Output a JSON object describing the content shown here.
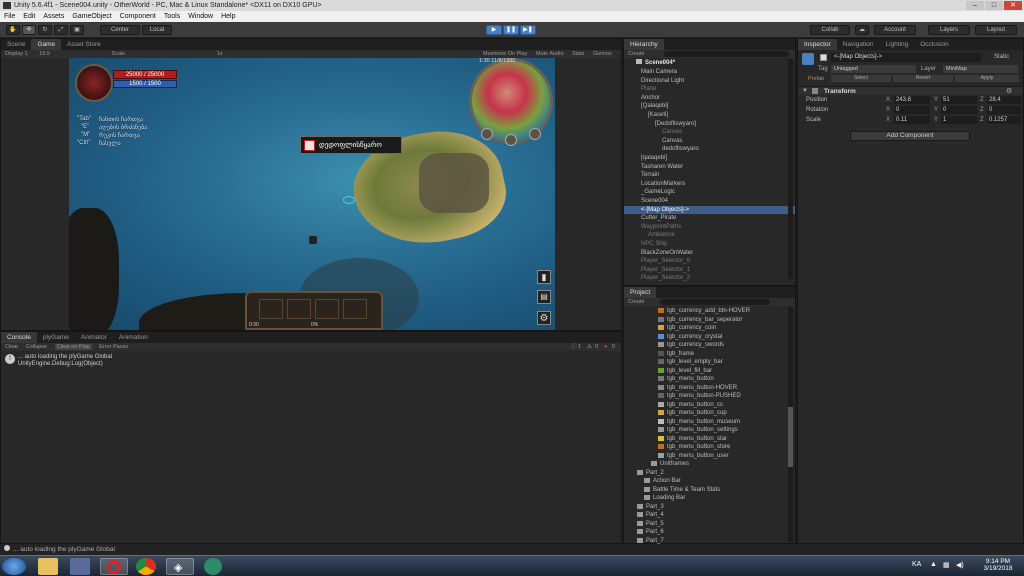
{
  "window": {
    "title": "Unity 5.6.4f1 - Scene004.unity - OtherWorld - PC, Mac & Linux Standalone* <DX11 on DX10 GPU>"
  },
  "menu": [
    "File",
    "Edit",
    "Assets",
    "GameObject",
    "Component",
    "Tools",
    "Window",
    "Help"
  ],
  "toolbar": {
    "pivot": "Center",
    "space": "Local",
    "collab": "Collab",
    "account": "Account",
    "layers": "Layers",
    "layout": "Layout"
  },
  "game_panel": {
    "tabs": [
      "Scene",
      "Game",
      "Asset Store"
    ],
    "display": "Display 1",
    "aspect": "16:9",
    "scale_label": "Scale",
    "scale_value": "1x",
    "maximize": "Maximize On Play",
    "mute": "Mute Audio",
    "stats": "Stats",
    "gizmos": "Gizmos"
  },
  "hud": {
    "hp": "25000 / 25000",
    "mp": "1500 / 1500",
    "minimap_info": "1:30     11/8/1990",
    "keys": [
      "\"Tab\"",
      "\"E\"",
      "\"M\"",
      "\"Ctrl\""
    ],
    "key_desc": [
      "ჩანთის ჩართვა",
      "აღების ბრძანება",
      "რუკის ჩართვა",
      "ჩასვლა"
    ],
    "location": "დედოფლისწყარო",
    "timer_left": "0:30",
    "timer_mid": "0%"
  },
  "hierarchy": {
    "tab": "Hierarchy",
    "create": "Create",
    "scene": "Scene004*",
    "items": [
      {
        "label": "Main Camera",
        "indent": 1,
        "style": ""
      },
      {
        "label": "Directional Light",
        "indent": 1,
        "style": ""
      },
      {
        "label": "Plane",
        "indent": 1,
        "style": "dim"
      },
      {
        "label": "Anchor",
        "indent": 1,
        "style": ""
      },
      {
        "label": "[Qalaqebi]",
        "indent": 1,
        "style": ""
      },
      {
        "label": "[Kaseti]",
        "indent": 2,
        "style": ""
      },
      {
        "label": "[Dedofliswyaro]",
        "indent": 3,
        "style": ""
      },
      {
        "label": "Canvas",
        "indent": 4,
        "style": "dim"
      },
      {
        "label": "Canvas",
        "indent": 4,
        "style": ""
      },
      {
        "label": "dedofliswyaro",
        "indent": 4,
        "style": ""
      },
      {
        "label": "[qalaqebi]",
        "indent": 1,
        "style": ""
      },
      {
        "label": "Tasharen Water",
        "indent": 1,
        "style": ""
      },
      {
        "label": "Terrain",
        "indent": 1,
        "style": ""
      },
      {
        "label": "LocationMarkers",
        "indent": 1,
        "style": ""
      },
      {
        "label": "_GameLogic",
        "indent": 1,
        "style": ""
      },
      {
        "label": "Scene004",
        "indent": 1,
        "style": ""
      },
      {
        "label": "<-[Map Objects]->",
        "indent": 1,
        "style": "sel"
      },
      {
        "label": "Cutter_Pirate",
        "indent": 1,
        "style": ""
      },
      {
        "label": "WaypointPaths",
        "indent": 1,
        "style": "dim"
      },
      {
        "label": "Ambience",
        "indent": 2,
        "style": "dim"
      },
      {
        "label": "NPC Ship",
        "indent": 1,
        "style": "dim"
      },
      {
        "label": "BlackZoneOnWater",
        "indent": 1,
        "style": ""
      },
      {
        "label": "Player_Selector_0",
        "indent": 1,
        "style": "dim"
      },
      {
        "label": "Player_Selector_1",
        "indent": 1,
        "style": "dim"
      },
      {
        "label": "Player_Selector_2",
        "indent": 1,
        "style": "dim"
      }
    ]
  },
  "project": {
    "tab": "Project",
    "create": "Create",
    "items": [
      {
        "label": "tgb_currency_add_btn-HOVER",
        "indent": 4,
        "icon": "#c8692a"
      },
      {
        "label": "tgb_currency_bar_seperator",
        "indent": 4,
        "icon": "#777"
      },
      {
        "label": "tgb_currency_coin",
        "indent": 4,
        "icon": "#d8a33a"
      },
      {
        "label": "tgb_currency_crystal",
        "indent": 4,
        "icon": "#5b8fd0"
      },
      {
        "label": "tgb_currency_swords",
        "indent": 4,
        "icon": "#999"
      },
      {
        "label": "tgb_frame",
        "indent": 4,
        "icon": "#555"
      },
      {
        "label": "tgb_level_empty_bar",
        "indent": 4,
        "icon": "#666"
      },
      {
        "label": "tgb_level_fill_bar",
        "indent": 4,
        "icon": "#6ba33a"
      },
      {
        "label": "tgb_menu_button",
        "indent": 4,
        "icon": "#777"
      },
      {
        "label": "tgb_menu_button-HOVER",
        "indent": 4,
        "icon": "#888"
      },
      {
        "label": "tgb_menu_button-PUSHED",
        "indent": 4,
        "icon": "#666"
      },
      {
        "label": "tgb_menu_button_cc",
        "indent": 4,
        "icon": "#aaa"
      },
      {
        "label": "tgb_menu_button_cup",
        "indent": 4,
        "icon": "#d8a33a"
      },
      {
        "label": "tgb_menu_button_museum",
        "indent": 4,
        "icon": "#bbb"
      },
      {
        "label": "tgb_menu_button_settings",
        "indent": 4,
        "icon": "#999"
      },
      {
        "label": "tgb_menu_button_star",
        "indent": 4,
        "icon": "#d8c23a"
      },
      {
        "label": "tgb_menu_button_store",
        "indent": 4,
        "icon": "#c8692a"
      },
      {
        "label": "tgb_menu_button_user",
        "indent": 4,
        "icon": "#8aa"
      },
      {
        "label": "Unitframes",
        "indent": 3,
        "icon": "folder"
      },
      {
        "label": "Part_2",
        "indent": 1,
        "icon": "folder"
      },
      {
        "label": "Action Bar",
        "indent": 2,
        "icon": "folder"
      },
      {
        "label": "Battle Time & Team Stats",
        "indent": 2,
        "icon": "folder"
      },
      {
        "label": "Loading Bar",
        "indent": 2,
        "icon": "folder"
      },
      {
        "label": "Part_3",
        "indent": 1,
        "icon": "folder"
      },
      {
        "label": "Part_4",
        "indent": 1,
        "icon": "folder"
      },
      {
        "label": "Part_5",
        "indent": 1,
        "icon": "folder"
      },
      {
        "label": "Part_6",
        "indent": 1,
        "icon": "folder"
      },
      {
        "label": "Part_7",
        "indent": 1,
        "icon": "folder"
      }
    ]
  },
  "inspector": {
    "tabs": [
      "Inspector",
      "Navigation",
      "Lighting",
      "Occlusion"
    ],
    "object_name": "<-[Map Objects]->",
    "static": "Static",
    "tag_label": "Tag",
    "tag_value": "Untagged",
    "layer_label": "Layer",
    "layer_value": "MiniMap",
    "prefab": "Prefab",
    "select": "Select",
    "revert": "Revert",
    "apply": "Apply",
    "transform": "Transform",
    "position": {
      "label": "Position",
      "x": "243.8",
      "y": "51",
      "z": "28.4"
    },
    "rotation": {
      "label": "Rotation",
      "x": "0",
      "y": "0",
      "z": "0"
    },
    "scale": {
      "label": "Scale",
      "x": "0.11",
      "y": "1",
      "z": "0.1257"
    },
    "add_component": "Add Component"
  },
  "console": {
    "tabs": [
      "Console",
      "plyGame",
      "Animator",
      "Animation"
    ],
    "buttons": [
      "Clear",
      "Collapse",
      "Clear on Play",
      "Error Pause"
    ],
    "counts": [
      "1",
      "0",
      "0"
    ],
    "log_line1": "... auto loading the plyGame Global",
    "log_line2": "UnityEngine.Debug:Log(Object)"
  },
  "statusbar": {
    "text": "... auto loading the plyGame Global"
  },
  "taskbar": {
    "lang": "KA",
    "time": "9:14 PM",
    "date": "3/19/2018"
  }
}
